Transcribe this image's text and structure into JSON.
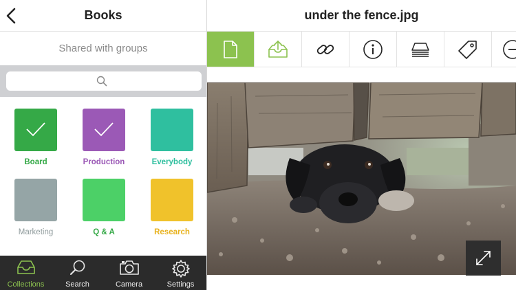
{
  "left_panel": {
    "title": "Books",
    "shared_label": "Shared with groups",
    "search": {
      "placeholder": ""
    },
    "groups": [
      {
        "name": "Board",
        "color": "#35a947",
        "label_color": "#35a947",
        "checked": true
      },
      {
        "name": "Production",
        "color": "#9b59b6",
        "label_color": "#9b59b6",
        "checked": true
      },
      {
        "name": "Everybody",
        "color": "#2fbf9f",
        "label_color": "#2fbf9f",
        "checked": false
      },
      {
        "name": "Marketing",
        "color": "#95a5a6",
        "label_color": "#8e9a9b",
        "checked": false
      },
      {
        "name": "Q & A",
        "color": "#4cd067",
        "label_color": "#35a947",
        "checked": false
      },
      {
        "name": "Research",
        "color": "#f0c22b",
        "label_color": "#e8b21e",
        "checked": false
      }
    ],
    "tabbar": [
      {
        "label": "Collections",
        "icon": "tray-icon",
        "active": true
      },
      {
        "label": "Search",
        "icon": "search-icon",
        "active": false
      },
      {
        "label": "Camera",
        "icon": "camera-icon",
        "active": false
      },
      {
        "label": "Settings",
        "icon": "gear-icon",
        "active": false
      }
    ]
  },
  "right_panel": {
    "title": "under the fence.jpg",
    "toolbar": [
      {
        "icon": "document-icon",
        "active": true
      },
      {
        "icon": "share-upload-icon",
        "active": false
      },
      {
        "icon": "link-icon",
        "active": false
      },
      {
        "icon": "info-icon",
        "active": false
      },
      {
        "icon": "stack-icon",
        "active": false
      },
      {
        "icon": "tag-icon",
        "active": false
      },
      {
        "icon": "add-icon",
        "active": false
      }
    ],
    "image_subject": "puppy-under-fence-image"
  },
  "colors": {
    "accent": "#8cc24f",
    "tabbar_bg": "#2b2b2b",
    "search_bg": "#cfd0d3"
  }
}
